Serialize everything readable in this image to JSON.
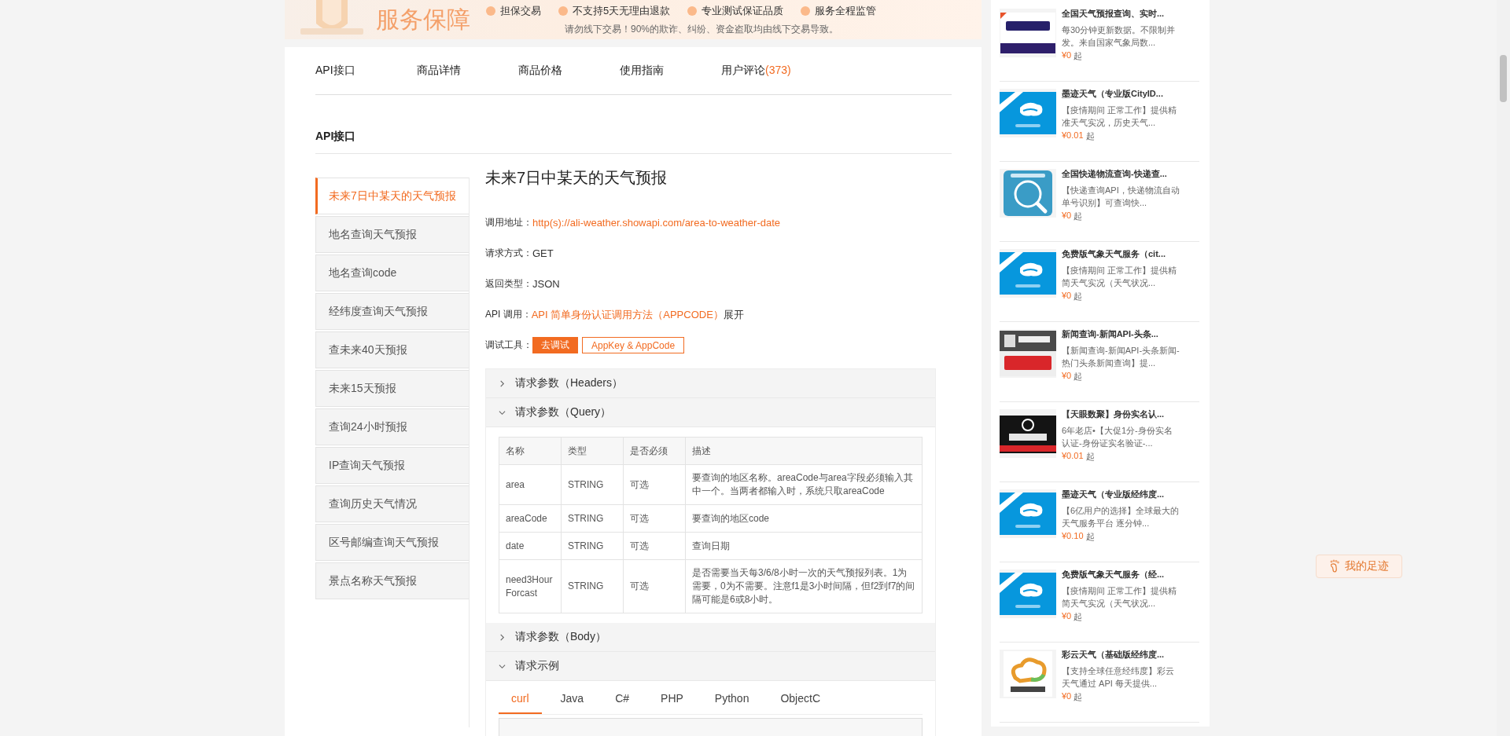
{
  "banner": {
    "title": "服务保障",
    "features": [
      "担保交易",
      "不支持5天无理由退款",
      "专业测试保证品质",
      "服务全程监管"
    ],
    "notice": "请勿线下交易！90%的欺诈、纠纷、资金盗取均由线下交易导致。"
  },
  "tabs": [
    {
      "label": "API接口"
    },
    {
      "label": "商品详情"
    },
    {
      "label": "商品价格"
    },
    {
      "label": "使用指南"
    },
    {
      "label": "用户评论",
      "count": "(373)"
    }
  ],
  "section_title": "API接口",
  "api_list": [
    {
      "label": "未来7日中某天的天气预报",
      "selected": true
    },
    {
      "label": "地名查询天气预报",
      "selected": false
    },
    {
      "label": "地名查询code",
      "selected": false
    },
    {
      "label": "经纬度查询天气预报",
      "selected": false
    },
    {
      "label": "查未来40天预报",
      "selected": false
    },
    {
      "label": "未来15天预报",
      "selected": false
    },
    {
      "label": "查询24小时预报",
      "selected": false
    },
    {
      "label": "IP查询天气预报",
      "selected": false
    },
    {
      "label": "查询历史天气情况",
      "selected": false
    },
    {
      "label": "区号邮编查询天气预报",
      "selected": false
    },
    {
      "label": "景点名称天气预报",
      "selected": false
    }
  ],
  "detail": {
    "title": "未来7日中某天的天气预报",
    "fields": [
      {
        "kind": "link",
        "label": "调用地址：",
        "value": "http(s)://ali-weather.showapi.com/area-to-weather-date"
      },
      {
        "kind": "text",
        "label": "请求方式：",
        "value": "GET"
      },
      {
        "kind": "text",
        "label": "返回类型：",
        "value": "JSON"
      },
      {
        "kind": "link",
        "label": "API 调用：",
        "value": "API 简单身份认证调用方法（APPCODE）",
        "extra": "展开"
      }
    ],
    "tools": {
      "label": "调试工具：",
      "buttons": [
        {
          "kind": "primary",
          "label": "去调试"
        },
        {
          "kind": "outline",
          "label": "AppKey & AppCode"
        }
      ]
    },
    "panels": [
      {
        "title": "请求参数（Headers）",
        "expanded": false
      },
      {
        "title": "请求参数（Query）",
        "expanded": true,
        "table": {
          "columns": [
            "名称",
            "类型",
            "是否必须",
            "描述"
          ],
          "rows": [
            [
              "area",
              "STRING",
              "可选",
              "要查询的地区名称。areaCode与area字段必须输入其中一个。当两者都输入时，系统只取areaCode"
            ],
            [
              "areaCode",
              "STRING",
              "可选",
              "要查询的地区code"
            ],
            [
              "date",
              "STRING",
              "可选",
              "查询日期"
            ],
            [
              "need3Hour Forcast",
              "STRING",
              "可选",
              "是否需要当天每3/6/8小时一次的天气预报列表。1为需要，0为不需要。注意f1是3小时间隔，但f2到f7的间隔可能是6或8小时。"
            ]
          ]
        }
      },
      {
        "title": "请求参数（Body）",
        "expanded": false
      },
      {
        "title": "请求示例",
        "expanded": true,
        "code_tabs": [
          {
            "label": "curl",
            "selected": true
          },
          {
            "label": "Java",
            "selected": false
          },
          {
            "label": "C#",
            "selected": false
          },
          {
            "label": "PHP",
            "selected": false
          },
          {
            "label": "Python",
            "selected": false
          },
          {
            "label": "ObjectC",
            "selected": false
          }
        ]
      }
    ]
  },
  "recommendations": [
    {
      "kind": "picture",
      "title": "全国天气预报查询、实时...",
      "description": "每30分钟更新数据。不限制并发。来自国家气象局数...",
      "price": "¥0",
      "unit": "起"
    },
    {
      "kind": "picture",
      "title": "墨迹天气（专业版CityID...",
      "description": "【疫情期间 正常工作】提供精准天气实况，历史天气...",
      "price": "¥0.01",
      "unit": "起"
    },
    {
      "kind": "picture",
      "title": "全国快递物流查询-快递查...",
      "description": "【快递查询API，快递物流自动单号识别】可查询快...",
      "price": "¥0",
      "unit": "起"
    },
    {
      "kind": "picture",
      "title": "免费版气象天气服务（cit...",
      "description": "【疫情期间 正常工作】提供精简天气实况（天气状况...",
      "price": "¥0",
      "unit": "起"
    },
    {
      "kind": "picture",
      "title": "新闻查询-新闻API-头条...",
      "description": "【新闻查询-新闻API-头条新闻-热门头条新闻查询】提...",
      "price": "¥0",
      "unit": "起"
    },
    {
      "kind": "picture",
      "title": "【天眼数聚】身份实名认...",
      "description": "6年老店•【大促1分-身份实名认证-身份证实名验证-...",
      "price": "¥0.01",
      "unit": "起"
    },
    {
      "kind": "picture",
      "title": "墨迹天气（专业版经纬度...",
      "description": "【6亿用户的选择】全球最大的天气服务平台 逐分钟...",
      "price": "¥0.10",
      "unit": "起"
    },
    {
      "kind": "picture",
      "title": "免费版气象天气服务（经...",
      "description": "【疫情期间 正常工作】提供精简天气实况（天气状况...",
      "price": "¥0",
      "unit": "起"
    },
    {
      "kind": "picture",
      "title": "彩云天气（基础版经纬度...",
      "description": "【支持全球任意经纬度】彩云天气通过 API 每天提供...",
      "price": "¥0",
      "unit": "起"
    }
  ],
  "footprint_button": "我的足迹"
}
